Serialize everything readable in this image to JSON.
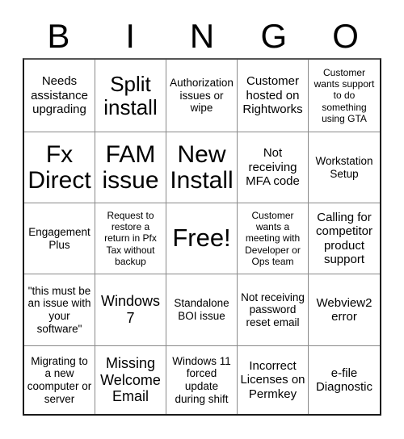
{
  "card": {
    "title": "BINGO",
    "header_letters": [
      "B",
      "I",
      "N",
      "G",
      "O"
    ],
    "rows": 5,
    "columns": 5,
    "border_color": "#1a1a1a",
    "gridline_color": "#8a8a8a",
    "background_color": "#ffffff",
    "text_color": "#000000",
    "cells": [
      {
        "text": "Needs assistance upgrading",
        "size": "s-md",
        "free": false
      },
      {
        "text": "Split install",
        "size": "s-xl",
        "free": false
      },
      {
        "text": "Authorization issues or wipe",
        "size": "s-sm",
        "free": false
      },
      {
        "text": "Customer hosted on Rightworks",
        "size": "s-md",
        "free": false
      },
      {
        "text": "Customer wants support to do something using GTA",
        "size": "s-xs",
        "free": false
      },
      {
        "text": "Fx Direct",
        "size": "s-xxl",
        "free": false
      },
      {
        "text": "FAM issue",
        "size": "s-xxl",
        "free": false
      },
      {
        "text": "New Install",
        "size": "s-xxl",
        "free": false
      },
      {
        "text": "Not receiving MFA code",
        "size": "s-md",
        "free": false
      },
      {
        "text": "Workstation Setup",
        "size": "s-sm",
        "free": false
      },
      {
        "text": "Engagement Plus",
        "size": "s-sm",
        "free": false
      },
      {
        "text": "Request to restore a return in Pfx Tax without backup",
        "size": "s-xs",
        "free": false
      },
      {
        "text": "Free!",
        "size": "s-free",
        "free": true
      },
      {
        "text": "Customer wants a meeting with Developer or Ops team",
        "size": "s-xs",
        "free": false
      },
      {
        "text": "Calling for competitor product support",
        "size": "s-md",
        "free": false
      },
      {
        "text": "\"this must be an issue with your software\"",
        "size": "s-sm",
        "free": false
      },
      {
        "text": "Windows 7",
        "size": "s-lg",
        "free": false
      },
      {
        "text": "Standalone BOI issue",
        "size": "s-sm",
        "free": false
      },
      {
        "text": "Not receiving password reset email",
        "size": "s-sm",
        "free": false
      },
      {
        "text": "Webview2 error",
        "size": "s-md",
        "free": false
      },
      {
        "text": "Migrating to a new coomputer or server",
        "size": "s-sm",
        "free": false
      },
      {
        "text": "Missing Welcome Email",
        "size": "s-lg",
        "free": false
      },
      {
        "text": "Windows 11 forced update during shift",
        "size": "s-sm",
        "free": false
      },
      {
        "text": "Incorrect Licenses on Permkey",
        "size": "s-md",
        "free": false
      },
      {
        "text": "e-file Diagnostic",
        "size": "s-md",
        "free": false
      }
    ]
  }
}
